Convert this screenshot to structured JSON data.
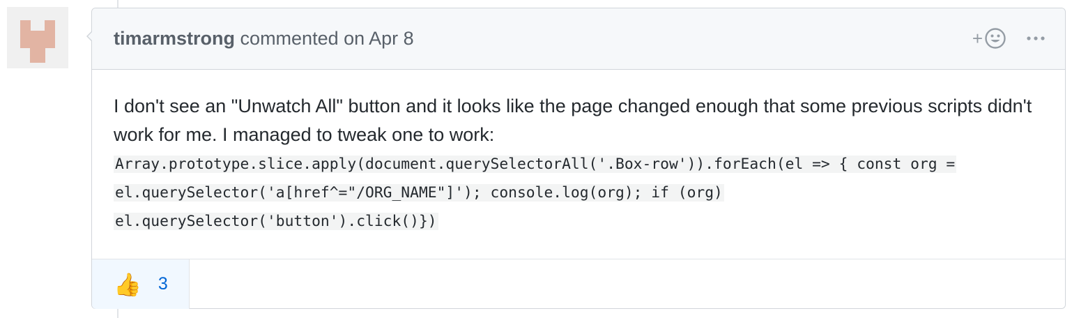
{
  "comment": {
    "author": "timarmstrong",
    "action_text": "commented on Apr 8",
    "body_text": "I don't see an \"Unwatch All\" button and it looks like the page changed enough that some previous scripts didn't work for me. I managed to tweak one to work:",
    "code": "Array.prototype.slice.apply(document.querySelectorAll('.Box-row')).forEach(el => { const org = el.querySelector('a[href^=\"/ORG_NAME\"]'); console.log(org); if (org) el.querySelector('button').click()})",
    "header_icons": {
      "add_reaction": "smiley-icon",
      "more": "kebab-horizontal-icon"
    }
  },
  "reactions": [
    {
      "emoji": "👍",
      "icon": "thumbs-up-icon",
      "count": "3"
    }
  ],
  "colors": {
    "header_bg": "#f6f8fa",
    "border": "#d1d5da",
    "reaction_bg": "#f1f8ff",
    "reaction_count": "#0366d6",
    "avatar": "#e2b4a3"
  }
}
